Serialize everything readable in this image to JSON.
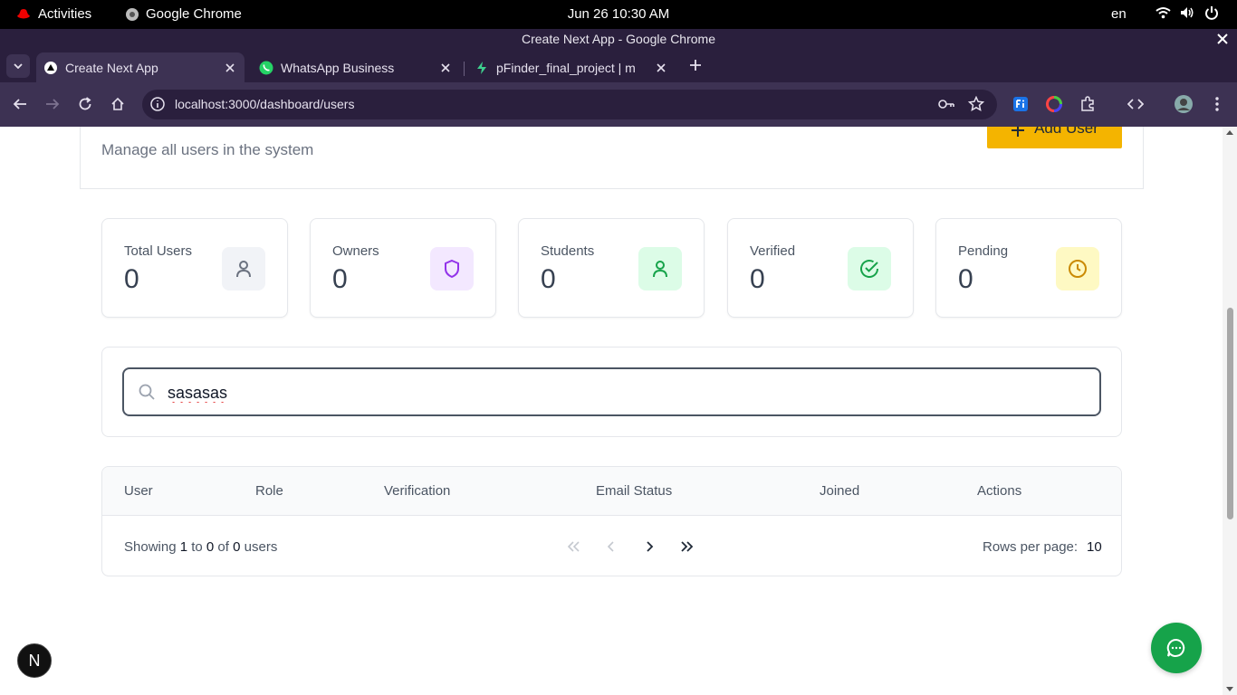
{
  "system": {
    "activities": "Activities",
    "app_name": "Google Chrome",
    "clock": "Jun 26  10:30 AM",
    "lang": "en"
  },
  "window": {
    "title": "Create Next App - Google Chrome"
  },
  "tabs": [
    {
      "title": "Create Next App",
      "favicon": "nextjs-triangle-icon"
    },
    {
      "title": "WhatsApp Business",
      "favicon": "whatsapp-icon"
    },
    {
      "title": "pFinder_final_project | m",
      "favicon": "supabase-icon"
    }
  ],
  "toolbar": {
    "url": "localhost:3000/dashboard/users"
  },
  "page": {
    "subtitle": "Manage all users in the system",
    "add_user_label": "Add User",
    "stats": [
      {
        "label": "Total Users",
        "value": "0",
        "icon": "user-icon",
        "color": "#6b7280",
        "bg": "#f1f3f7"
      },
      {
        "label": "Owners",
        "value": "0",
        "icon": "shield-icon",
        "color": "#9333ea",
        "bg": "#f3e8ff"
      },
      {
        "label": "Students",
        "value": "0",
        "icon": "user-icon",
        "color": "#16a34a",
        "bg": "#dcfce7"
      },
      {
        "label": "Verified",
        "value": "0",
        "icon": "check-circle-icon",
        "color": "#16a34a",
        "bg": "#dcfce7"
      },
      {
        "label": "Pending",
        "value": "0",
        "icon": "clock-icon",
        "color": "#ca8a04",
        "bg": "#fef9c3"
      }
    ],
    "search": {
      "value": "sasasas"
    },
    "table": {
      "columns": [
        "User",
        "Role",
        "Verification",
        "Email Status",
        "Joined",
        "Actions"
      ],
      "showing_prefix": "Showing ",
      "showing_from": "1",
      "showing_to_word": " to ",
      "showing_to": "0",
      "showing_of_word": " of ",
      "showing_total": "0",
      "showing_suffix": " users",
      "rows_per_page_label": "Rows per page:",
      "rows_per_page": "10"
    }
  },
  "next_badge": "N"
}
